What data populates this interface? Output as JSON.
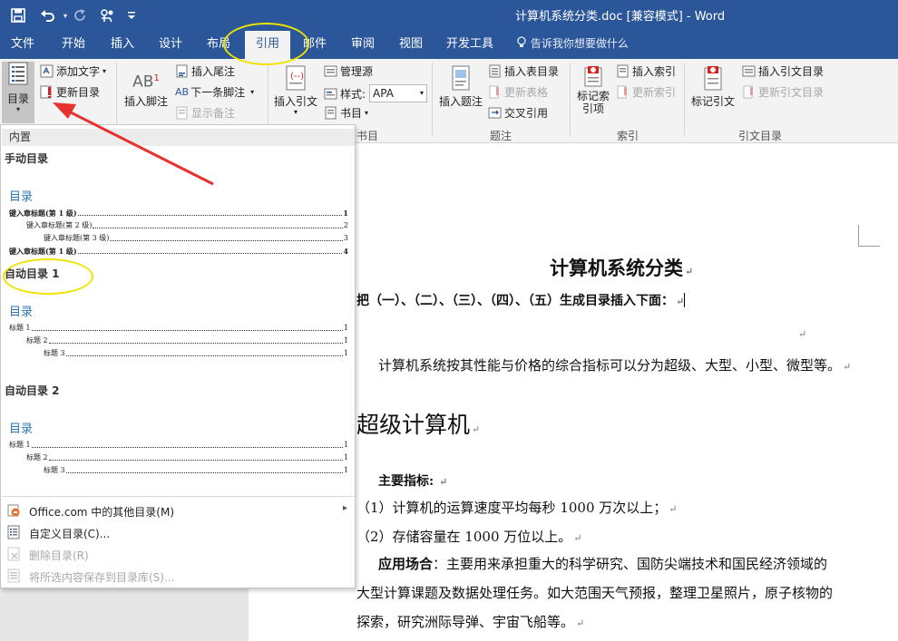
{
  "quick_access": {
    "save_icon": "save-icon",
    "undo_icon": "undo-icon",
    "redo_icon": "redo-icon",
    "touch_icon": "touch-mode-icon",
    "customize_icon": "customize-qat-icon"
  },
  "window_title": "计算机系统分类.doc [兼容模式] - Word",
  "tabs": [
    "文件",
    "开始",
    "插入",
    "设计",
    "布局",
    "引用",
    "邮件",
    "审阅",
    "视图",
    "开发工具"
  ],
  "active_tab": "引用",
  "tell_me": "告诉我你想要做什么",
  "ribbon": {
    "toc_button": "目录",
    "add_text": "添加文字",
    "update_toc": "更新目录",
    "insert_footnote": "插入脚注",
    "insert_endnote": "插入尾注",
    "next_footnote": "下一条脚注",
    "show_notes": "显示备注",
    "insert_citation": "插入引文",
    "manage_sources": "管理源",
    "style_label": "样式:",
    "style_value": "APA",
    "bibliography": "书目",
    "insert_caption": "插入题注",
    "insert_table_of_figures": "插入表目录",
    "update_table": "更新表格",
    "cross_reference": "交叉引用",
    "mark_entry": "标记索引项",
    "insert_index": "插入索引",
    "update_index": "更新索引",
    "mark_citation": "标记引文",
    "insert_table_of_authorities": "插入引文目录",
    "update_table_of_authorities": "更新引文目录",
    "groups": {
      "citations_partial": "书目",
      "captions": "题注",
      "index": "索引",
      "authorities": "引文目录"
    }
  },
  "dropdown": {
    "header": "内置",
    "sections": [
      {
        "name": "手动目录",
        "title": "目录",
        "lines": [
          {
            "text": "键入章标题(第 1 级)",
            "page": "1",
            "bold": true
          },
          {
            "text": "键入章标题(第 2 级)",
            "page": "2",
            "bold": false
          },
          {
            "text": "键入章标题(第 3 级)",
            "page": "3",
            "bold": false
          },
          {
            "text": "键入章标题(第 1 级)",
            "page": "4",
            "bold": true
          }
        ]
      },
      {
        "name": "自动目录 1",
        "title": "目录",
        "lines": [
          {
            "text": "标题 1",
            "page": "1"
          },
          {
            "text": "标题 2",
            "page": "1"
          },
          {
            "text": "标题 3",
            "page": "1"
          }
        ]
      },
      {
        "name": "自动目录 2",
        "title": "目录",
        "lines": [
          {
            "text": "标题 1",
            "page": "1"
          },
          {
            "text": "标题 2",
            "page": "1"
          },
          {
            "text": "标题 3",
            "page": "1"
          }
        ]
      }
    ],
    "menu": [
      {
        "label": "Office.com 中的其他目录(M)",
        "disabled": false,
        "icon": "office-icon"
      },
      {
        "label": "自定义目录(C)...",
        "disabled": false,
        "icon": "custom-toc-icon"
      },
      {
        "label": "删除目录(R)",
        "disabled": true,
        "icon": "remove-toc-icon"
      },
      {
        "label": "将所选内容保存到目录库(S)...",
        "disabled": true,
        "icon": "save-to-gallery-icon"
      }
    ]
  },
  "document": {
    "title": "计算机系统分类",
    "instruction": "把（一）、（二）、（三）、（四）、（五）生成目录插入下面：",
    "intro": "计算机系统按其性能与价格的综合指标可以分为超级、大型、小型、微型等。",
    "heading": "超级计算机",
    "main_label": "主要指标:",
    "item1": "（1）计算机的运算速度平均每秒 1000 万次以上；",
    "item2": "（2）存储容量在 1000 万位以上。",
    "app_label": "应用场合",
    "app_text": "：主要用来承担重大的科学研究、国防尖端技术和国民经济领域的",
    "app_line2": "大型计算课题及数据处理任务。如大范围天气预报，整理卫星照片，原子核物的",
    "app_line3": "探索，研究洲际导弹、宇宙飞船等。"
  },
  "colors": {
    "ribbon_blue": "#2b579a",
    "annotation_yellow": "#f2e200",
    "arrow_red": "#e8322f",
    "toc_title_blue": "#2e74b5"
  }
}
